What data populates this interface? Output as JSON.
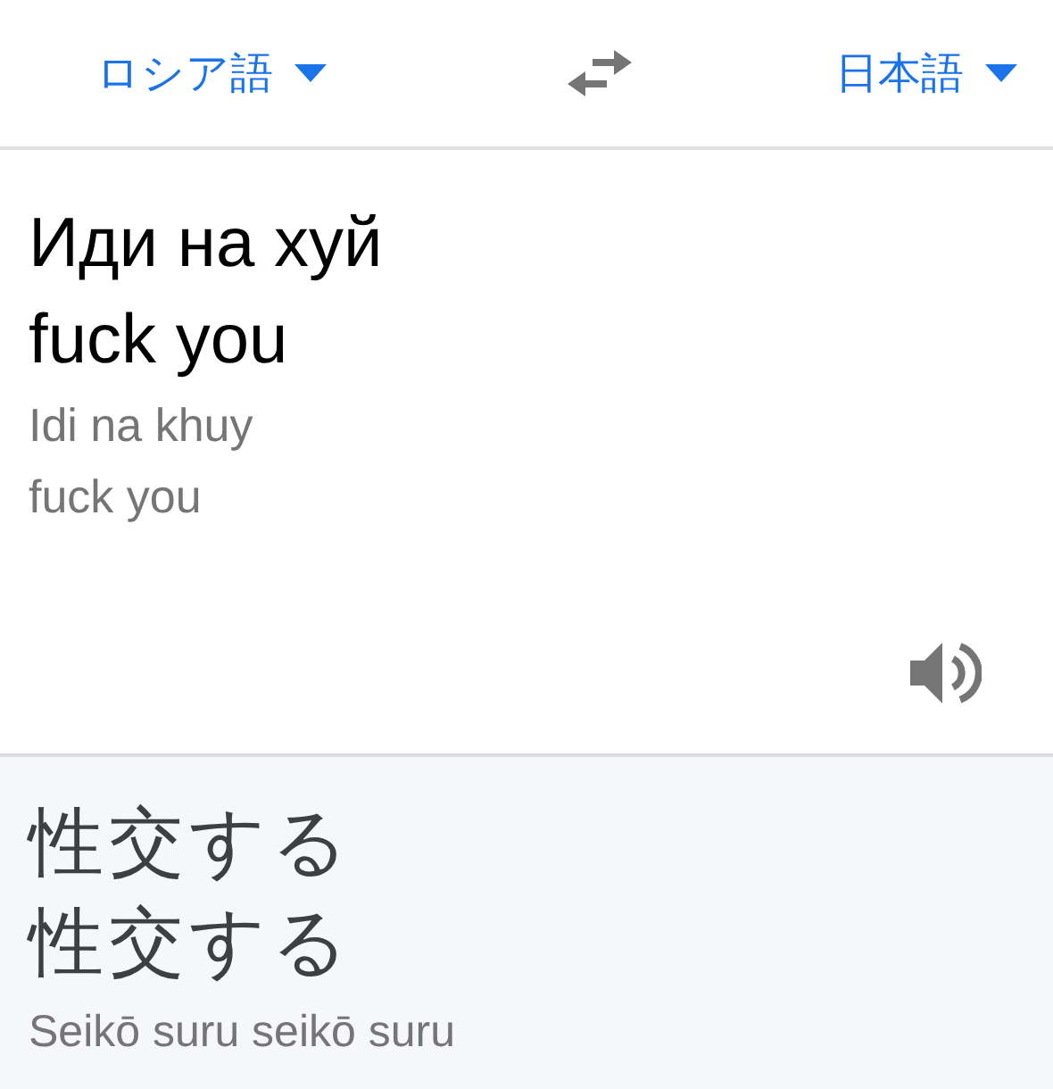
{
  "languages": {
    "source": "ロシア語",
    "target": "日本語"
  },
  "source": {
    "lines": [
      "Иди на хуй",
      "fuck you"
    ],
    "romanization": [
      "Idi na khuy",
      "fuck you"
    ]
  },
  "result": {
    "lines": [
      "性交する",
      "性交する"
    ],
    "romanization": "Seikō suru seikō suru"
  }
}
